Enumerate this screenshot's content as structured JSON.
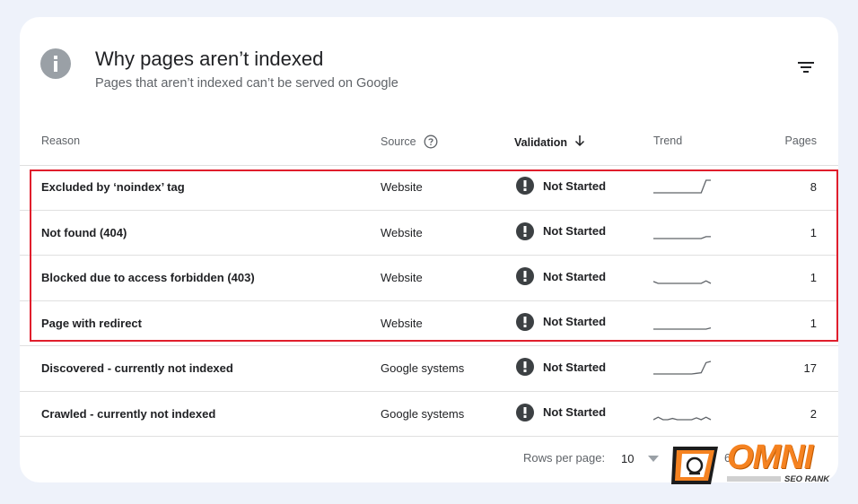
{
  "header": {
    "title": "Why pages aren’t indexed",
    "subtitle": "Pages that aren’t indexed can’t be served on Google"
  },
  "columns": {
    "reason": "Reason",
    "source": "Source",
    "validation": "Validation",
    "trend": "Trend",
    "pages": "Pages"
  },
  "rows": [
    {
      "reason": "Excluded by ‘noindex’ tag",
      "source": "Website",
      "validation": "Not Started",
      "pages": "8",
      "trend": [
        0,
        0,
        0,
        0,
        0,
        0,
        0,
        0,
        0,
        0,
        0,
        1,
        1
      ]
    },
    {
      "reason": "Not found (404)",
      "source": "Website",
      "validation": "Not Started",
      "pages": "1",
      "trend": [
        0,
        0,
        0,
        0,
        0,
        0,
        0,
        0,
        0,
        0,
        0,
        0.15,
        0.15
      ]
    },
    {
      "reason": "Blocked due to access forbidden (403)",
      "source": "Website",
      "validation": "Not Started",
      "pages": "1",
      "trend": [
        0.15,
        0,
        0,
        0,
        0,
        0,
        0,
        0,
        0,
        0,
        0,
        0.2,
        0
      ]
    },
    {
      "reason": "Page with redirect",
      "source": "Website",
      "validation": "Not Started",
      "pages": "1",
      "trend": [
        0,
        0,
        0,
        0,
        0,
        0,
        0,
        0,
        0,
        0,
        0,
        0,
        0.1
      ]
    },
    {
      "reason": "Discovered - currently not indexed",
      "source": "Google systems",
      "validation": "Not Started",
      "pages": "17",
      "trend": [
        0,
        0,
        0,
        0,
        0,
        0,
        0,
        0,
        0,
        0.05,
        0.1,
        0.9,
        1
      ]
    },
    {
      "reason": "Crawled - currently not indexed",
      "source": "Google systems",
      "validation": "Not Started",
      "pages": "2",
      "trend": [
        0,
        0.2,
        0,
        0,
        0.1,
        0,
        0,
        0,
        0,
        0.15,
        0,
        0.2,
        0
      ]
    }
  ],
  "footer": {
    "rows_per_page_label": "Rows per page:",
    "rows_per_page_value": "10",
    "page_range": "6"
  },
  "logo": {
    "name": "OMNI",
    "tagline": "SEO RANK"
  },
  "colors": {
    "highlight": "#e01e2c",
    "alert": "#3c4043",
    "brand": "#f58220"
  }
}
